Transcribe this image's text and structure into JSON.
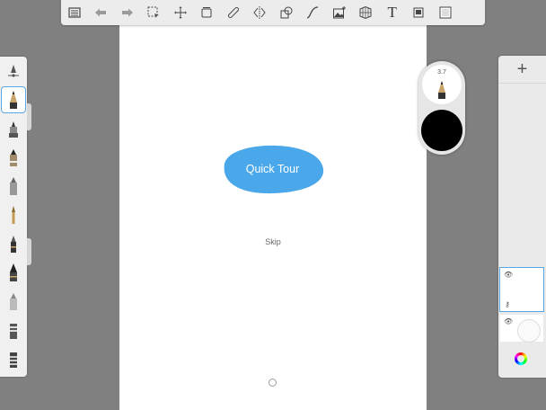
{
  "toolbar": {
    "items": [
      {
        "name": "list-icon"
      },
      {
        "name": "undo-icon"
      },
      {
        "name": "redo-icon"
      },
      {
        "name": "selection-icon"
      },
      {
        "name": "transform-icon"
      },
      {
        "name": "layers-stack-icon"
      },
      {
        "name": "ruler-icon"
      },
      {
        "name": "symmetry-icon"
      },
      {
        "name": "shapes-icon"
      },
      {
        "name": "curve-icon"
      },
      {
        "name": "image-add-icon"
      },
      {
        "name": "perspective-icon"
      },
      {
        "name": "text-icon",
        "glyph": "T"
      },
      {
        "name": "fill-icon"
      },
      {
        "name": "canvas-icon"
      }
    ]
  },
  "puck": {
    "size_value": "3.7",
    "color": "#000000"
  },
  "layers": {
    "add_label": "+"
  },
  "overlay": {
    "quick_tour_label": "Quick Tour",
    "skip_label": "Skip",
    "accent": "#4aa8ea"
  },
  "colors": {
    "background": "#808080",
    "selection": "#5aa7e8"
  }
}
